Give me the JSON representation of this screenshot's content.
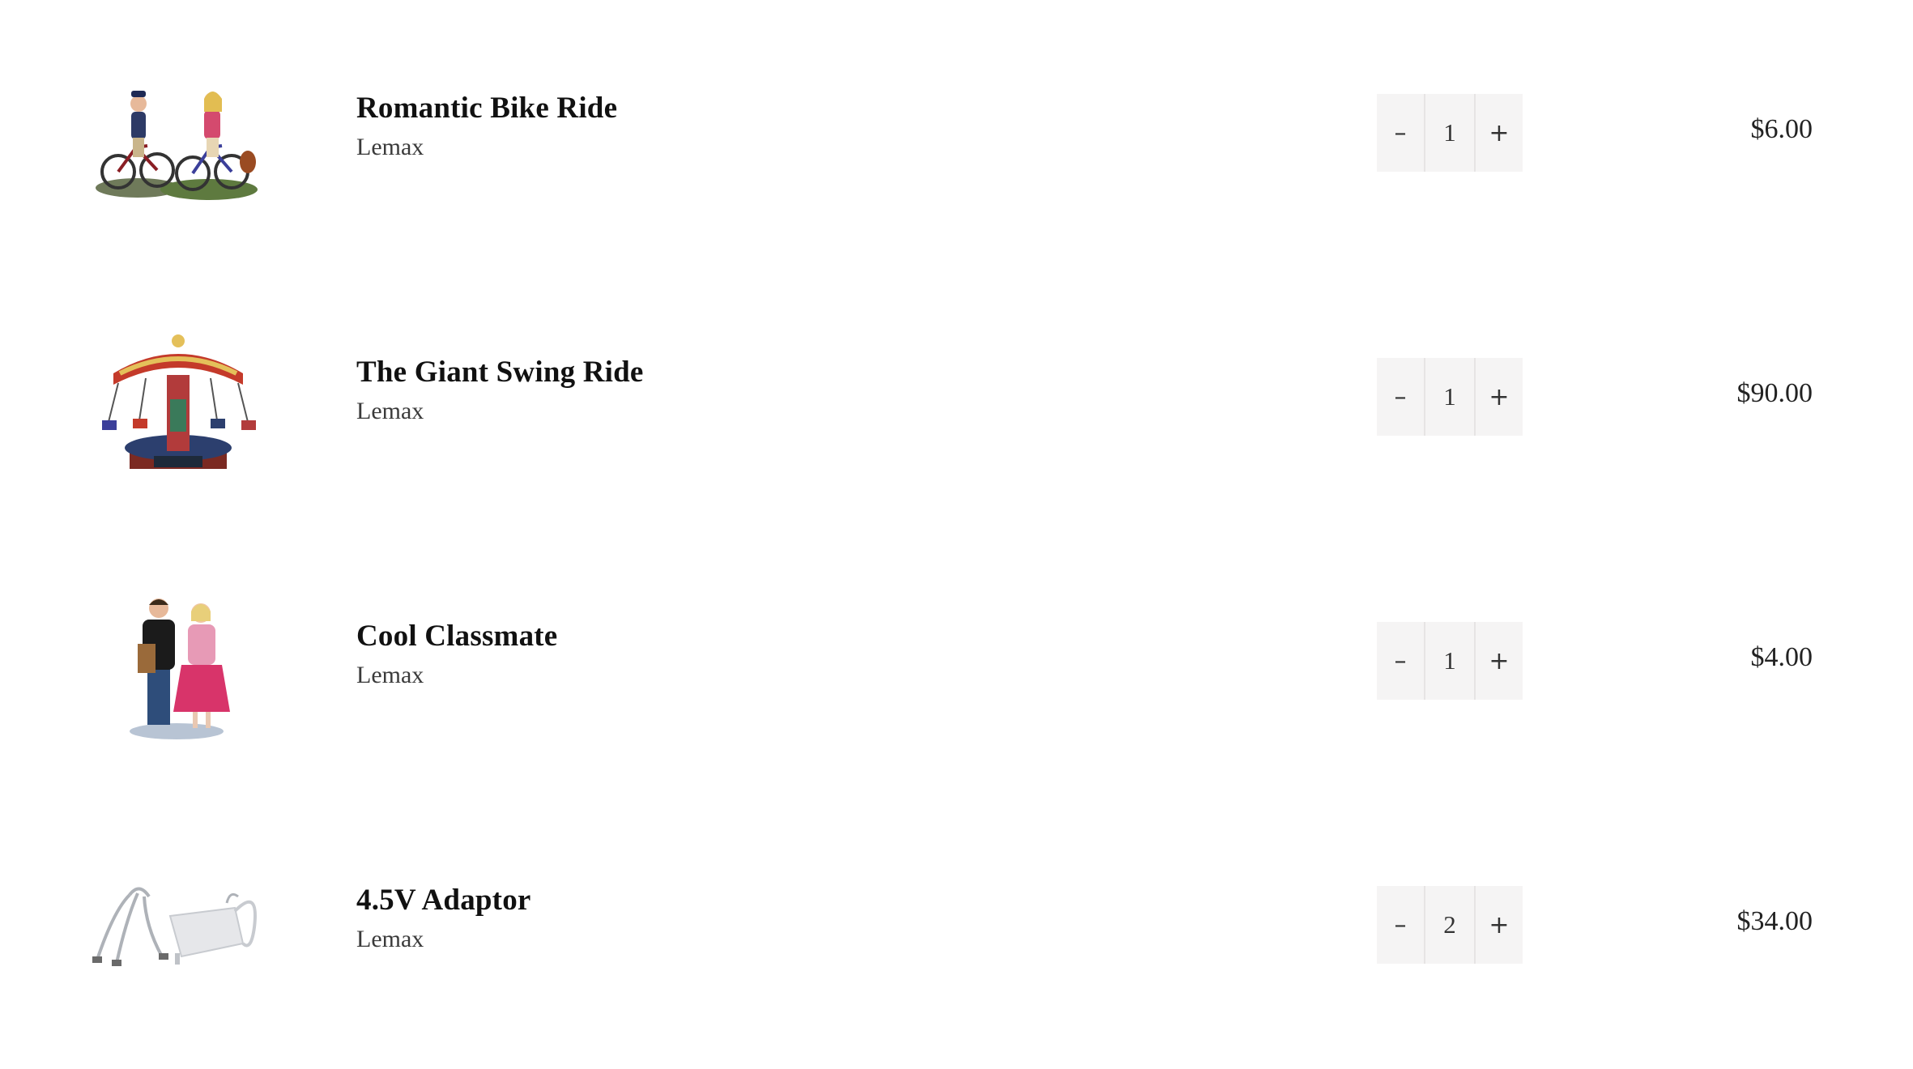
{
  "cart": {
    "items": [
      {
        "title": "Romantic Bike Ride",
        "brand": "Lemax",
        "quantity": "1",
        "decrement": "–",
        "increment": "+",
        "price": "$6.00",
        "image_icon": "bike-riders-figurine-icon"
      },
      {
        "title": "The Giant Swing Ride",
        "brand": "Lemax",
        "quantity": "1",
        "decrement": "–",
        "increment": "+",
        "price": "$90.00",
        "image_icon": "carousel-swing-ride-icon"
      },
      {
        "title": "Cool Classmate",
        "brand": "Lemax",
        "quantity": "1",
        "decrement": "–",
        "increment": "+",
        "price": "$4.00",
        "image_icon": "couple-figurine-icon"
      },
      {
        "title": "4.5V Adaptor",
        "brand": "Lemax",
        "quantity": "2",
        "decrement": "–",
        "increment": "+",
        "price": "$34.00",
        "image_icon": "power-adaptor-icon"
      }
    ]
  },
  "colors": {
    "background": "#ffffff",
    "stepper_background": "#f5f4f4",
    "stepper_divider": "#e6e4e4",
    "text": "#111111"
  }
}
